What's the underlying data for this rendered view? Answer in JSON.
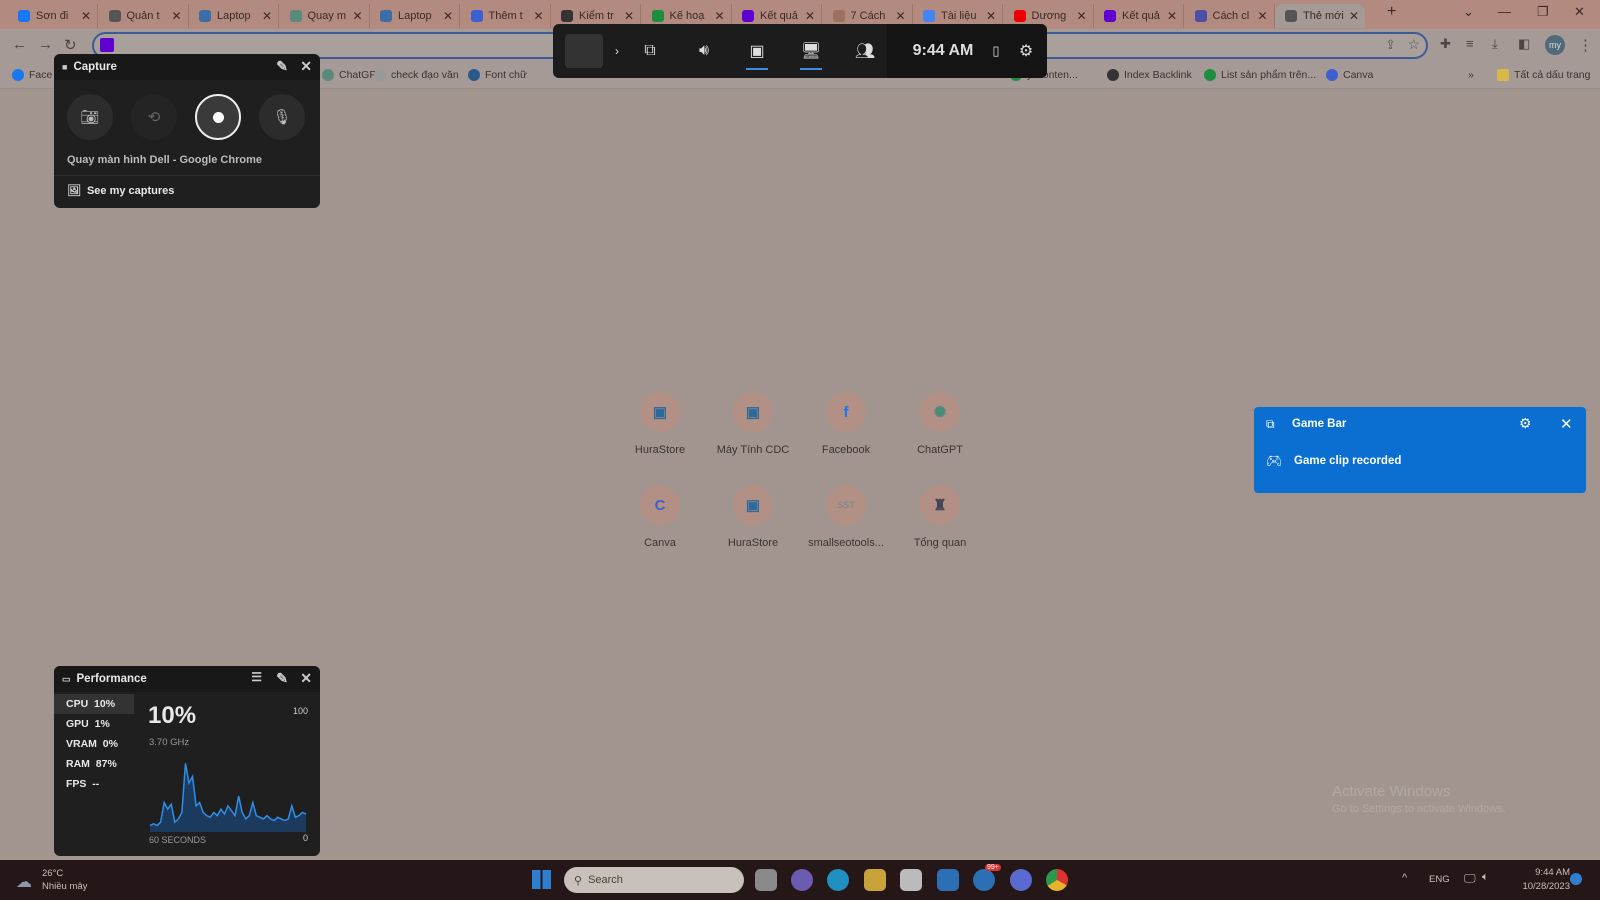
{
  "browser": {
    "tabs": [
      {
        "label": "Sơn đi",
        "color": "#1877f2"
      },
      {
        "label": "Quản t",
        "color": "#555"
      },
      {
        "label": "Laptop",
        "color": "#3b6ea5"
      },
      {
        "label": "Quay m",
        "color": "#5a8a7a"
      },
      {
        "label": "Laptop",
        "color": "#3b6ea5"
      },
      {
        "label": "Thêm t",
        "color": "#3d5fd0"
      },
      {
        "label": "Kiểm tr",
        "color": "#333"
      },
      {
        "label": "Kế hoạ",
        "color": "#1e8e3e"
      },
      {
        "label": "Kết quả",
        "color": "#5f01d1"
      },
      {
        "label": "7 Cách",
        "color": "#a07060"
      },
      {
        "label": "Tài liệu",
        "color": "#4285f4"
      },
      {
        "label": "Dương",
        "color": "#e00"
      },
      {
        "label": "Kết quả",
        "color": "#5f01d1"
      },
      {
        "label": "Cách cl",
        "color": "#4b4fa8"
      },
      {
        "label": "Thẻ mới",
        "color": "#555"
      }
    ],
    "new_tab": "+",
    "bookmarks": [
      {
        "label": "Face",
        "color": "#1877f2"
      },
      {
        "label": "ChatGPT",
        "color": "#5a8a7a"
      },
      {
        "label": "check đạo văn",
        "color": "#999"
      },
      {
        "label": "Font chữ",
        "color": "#2a5a8a"
      },
      {
        "label": "y Conten...",
        "color": "#1e8e3e"
      },
      {
        "label": "Index Backlink",
        "color": "#333"
      },
      {
        "label": "List sản phẩm trên...",
        "color": "#1e8e3e"
      },
      {
        "label": "Canva",
        "color": "#3d5fd0"
      }
    ],
    "all_bookmarks": "Tất cả dấu trang",
    "avatar": "my"
  },
  "gamebar": {
    "time": "9:44 AM"
  },
  "capture": {
    "title": "Capture",
    "source": "Quay màn hình Dell - Google Chrome",
    "see_captures": "See my captures"
  },
  "shortcuts": [
    {
      "label": "HuraStore",
      "glyph": "▣",
      "color": "#2b6a9a"
    },
    {
      "label": "Máy Tính CDC",
      "glyph": "▣",
      "color": "#2b6a9a"
    },
    {
      "label": "Facebook",
      "glyph": "f",
      "color": "#1877f2"
    },
    {
      "label": "ChatGPT",
      "glyph": "✺",
      "color": "#4a8a76"
    },
    {
      "label": "Canva",
      "glyph": "C",
      "color": "#3d5fd0"
    },
    {
      "label": "HuraStore",
      "glyph": "▣",
      "color": "#2b6a9a"
    },
    {
      "label": "smallseotools...",
      "glyph": "SST",
      "color": "#888"
    },
    {
      "label": "Tổng quan",
      "glyph": "♜",
      "color": "#445"
    }
  ],
  "toast": {
    "app": "Game Bar",
    "message": "Game clip recorded",
    "color": "#0a6fd1"
  },
  "performance": {
    "title": "Performance",
    "metrics": [
      {
        "name": "CPU",
        "value": "10%"
      },
      {
        "name": "GPU",
        "value": "1%"
      },
      {
        "name": "VRAM",
        "value": "0%"
      },
      {
        "name": "RAM",
        "value": "87%"
      },
      {
        "name": "FPS",
        "value": "--"
      }
    ],
    "big_value": "10%",
    "freq": "3.70 GHz",
    "max": "100",
    "min": "0",
    "span": "60 SECONDS",
    "cpu_history": [
      4,
      5,
      4,
      6,
      18,
      14,
      17,
      6,
      8,
      12,
      42,
      30,
      34,
      16,
      18,
      12,
      10,
      9,
      12,
      10,
      14,
      11,
      16,
      13,
      10,
      22,
      12,
      8,
      10,
      18,
      10,
      9,
      8,
      10,
      8,
      7,
      9,
      8,
      7,
      8,
      16,
      9,
      10,
      12,
      11
    ]
  },
  "watermark": {
    "title": "Activate Windows",
    "subtitle": "Go to Settings to activate Windows."
  },
  "taskbar": {
    "weather_temp": "26°C",
    "weather_desc": "Nhiều mây",
    "search": "Search",
    "lang": "ENG",
    "time": "9:44 AM",
    "date": "10/28/2023",
    "badge": "99+"
  }
}
